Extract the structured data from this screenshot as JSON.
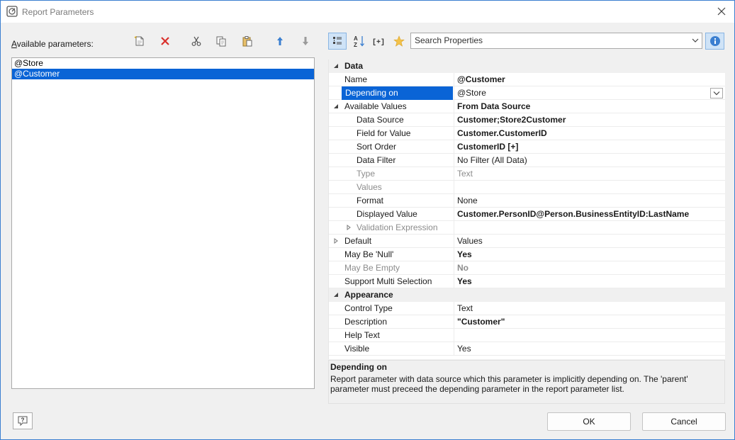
{
  "window": {
    "title": "Report Parameters"
  },
  "left": {
    "label_prefix": "A",
    "label_rest": "vailable parameters:",
    "parameters": [
      "@Store",
      "@Customer"
    ],
    "selected_index": 1
  },
  "search": {
    "placeholder": "Search Properties"
  },
  "properties": [
    {
      "name": "Data",
      "value": "",
      "kind": "category",
      "expander": "collapse",
      "indent": 0
    },
    {
      "name": "Name",
      "value": "@Customer",
      "bold": true,
      "indent": 1
    },
    {
      "name": "Depending on",
      "value": "@Store",
      "selected": true,
      "dropdown": true,
      "indent": 1
    },
    {
      "name": "Available Values",
      "value": "From Data Source",
      "bold": true,
      "expander": "collapse",
      "indent": 1
    },
    {
      "name": "Data Source",
      "value": "Customer;Store2Customer",
      "bold": true,
      "indent": 2
    },
    {
      "name": "Field for Value",
      "value": "Customer.CustomerID",
      "bold": true,
      "indent": 2
    },
    {
      "name": "Sort Order",
      "value": "CustomerID [+]",
      "bold": true,
      "indent": 2
    },
    {
      "name": "Data Filter",
      "value": "No Filter (All Data)",
      "indent": 2
    },
    {
      "name": "Type",
      "value": "Text",
      "dim": true,
      "indent": 2
    },
    {
      "name": "Values",
      "value": "",
      "dim": true,
      "indent": 2
    },
    {
      "name": "Format",
      "value": "None",
      "indent": 2
    },
    {
      "name": "Displayed Value",
      "value": "Customer.PersonID@Person.BusinessEntityID:LastName",
      "bold": true,
      "indent": 2
    },
    {
      "name": "Validation Expression",
      "value": "",
      "dim": true,
      "expander": "expand",
      "indent": 2
    },
    {
      "name": "Default",
      "value": "Values",
      "expander": "expand",
      "indent": 1
    },
    {
      "name": "May Be 'Null'",
      "value": "Yes",
      "bold": true,
      "indent": 1
    },
    {
      "name": "May Be Empty",
      "value": "No",
      "bold": true,
      "dim": true,
      "indent": 1
    },
    {
      "name": "Support Multi Selection",
      "value": "Yes",
      "bold": true,
      "indent": 1
    },
    {
      "name": "Appearance",
      "value": "",
      "kind": "category",
      "expander": "collapse",
      "indent": 0
    },
    {
      "name": "Control Type",
      "value": "Text",
      "indent": 1
    },
    {
      "name": "Description",
      "value": "\"Customer\"",
      "bold": true,
      "indent": 1
    },
    {
      "name": "Help Text",
      "value": "",
      "indent": 1
    },
    {
      "name": "Visible",
      "value": "Yes",
      "indent": 1
    }
  ],
  "description": {
    "title": "Depending on",
    "text": "Report parameter with data source which this parameter is implicitly depending on. The 'parent' parameter must preceed the depending parameter in the report parameter list."
  },
  "buttons": {
    "ok": "OK",
    "cancel": "Cancel"
  },
  "colors": {
    "selection": "#0a64d6",
    "accent": "#3b7fd0",
    "delete": "#d9302c"
  }
}
